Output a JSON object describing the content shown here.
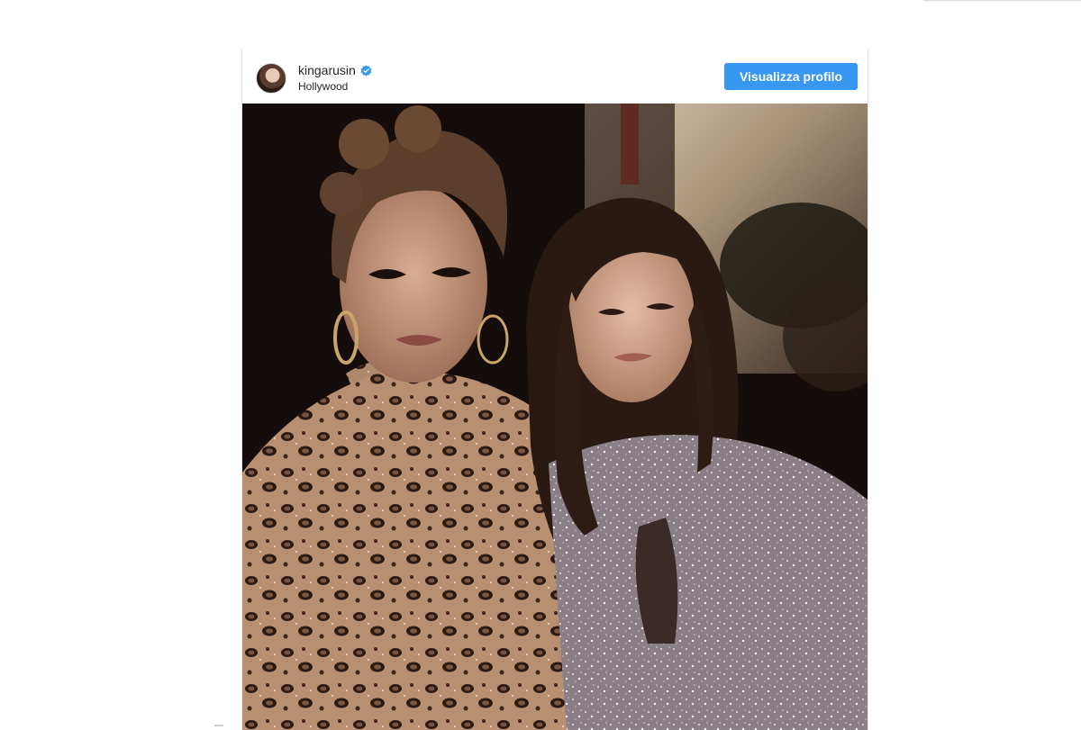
{
  "post": {
    "username": "kingarusin",
    "verified": true,
    "location": "Hollywood",
    "view_profile_label": "Visualizza profilo",
    "accent_color": "#3897f0",
    "verified_color": "#3897f0"
  },
  "photo": {
    "subject": "photo-of-two-women"
  }
}
